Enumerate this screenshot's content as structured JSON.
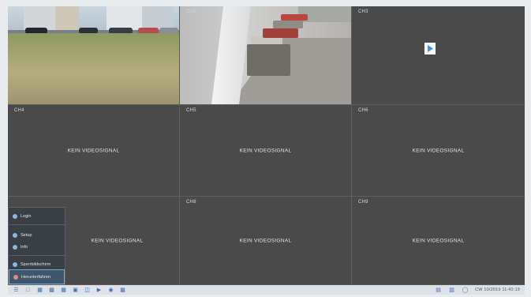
{
  "cells": [
    {
      "id": "ch1",
      "label": "",
      "type": "camera-street"
    },
    {
      "id": "ch2",
      "label": "CH2",
      "type": "camera-bins"
    },
    {
      "id": "ch3",
      "label": "CH3",
      "type": "play"
    },
    {
      "id": "ch4",
      "label": "CH4",
      "novideo": "KEIN VIDEOSIGNAL"
    },
    {
      "id": "ch5",
      "label": "CH5",
      "novideo": "KEIN VIDEOSIGNAL"
    },
    {
      "id": "ch6",
      "label": "CH6",
      "novideo": "KEIN VIDEOSIGNAL"
    },
    {
      "id": "ch7",
      "label": "",
      "novideo": "KEIN VIDEOSIGNAL"
    },
    {
      "id": "ch8",
      "label": "CH8",
      "novideo": "KEIN VIDEOSIGNAL"
    },
    {
      "id": "ch9",
      "label": "CH9",
      "novideo": "KEIN VIDEOSIGNAL"
    }
  ],
  "menu": {
    "items": [
      {
        "label": "Login",
        "icon": "user-icon"
      },
      {
        "label": "Setup",
        "icon": "gear-icon"
      },
      {
        "label": "Info",
        "icon": "info-icon"
      },
      {
        "label": "Sperrbildschirm",
        "icon": "lock-icon"
      },
      {
        "label": "Herunterfahren",
        "icon": "power-icon",
        "selected": true
      }
    ]
  },
  "taskbar": {
    "left_icons": [
      "menu-icon",
      "layout-1-icon",
      "layout-4-icon",
      "layout-9-icon",
      "layout-16-icon",
      "layout-custom-icon",
      "sequence-icon",
      "playback-icon",
      "record-icon",
      "snapshot-icon"
    ],
    "right_icons": [
      "network-icon",
      "hdd-icon",
      "volume-icon"
    ],
    "clock": "CW 10/2019 11:42:19"
  },
  "colors": {
    "screen_bg": "#4a4a4a",
    "accent": "#6fa8dc",
    "taskbar_bg": "#dde3e8"
  }
}
